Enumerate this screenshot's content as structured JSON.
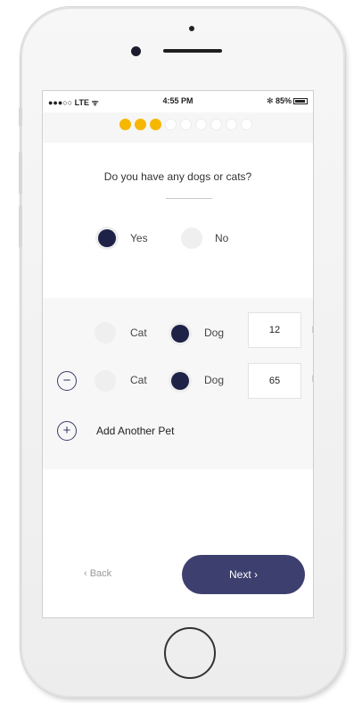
{
  "status_bar": {
    "carrier": "●●●○○ LTE ᯤ",
    "time": "4:55 PM",
    "battery": "✻ 85%"
  },
  "progress": {
    "total_steps": 9,
    "completed_steps": 3
  },
  "question": {
    "text": "Do you have any dogs or cats?",
    "options": [
      "Yes",
      "No"
    ],
    "selected": "Yes"
  },
  "pets": [
    {
      "cat_label": "Cat",
      "dog_label": "Dog",
      "selected": "Dog",
      "weight": "12",
      "unit": "lbs"
    },
    {
      "cat_label": "Cat",
      "dog_label": "Dog",
      "selected": "Dog",
      "weight": "65",
      "unit": "lbs"
    }
  ],
  "add_pet": {
    "label": "Add Another Pet"
  },
  "footer": {
    "back_label": "‹  Back",
    "next_label": "Next  ›"
  },
  "colors": {
    "accent": "#f5b700",
    "primary": "#3d3f6e",
    "selected_radio": "#1e2247"
  }
}
